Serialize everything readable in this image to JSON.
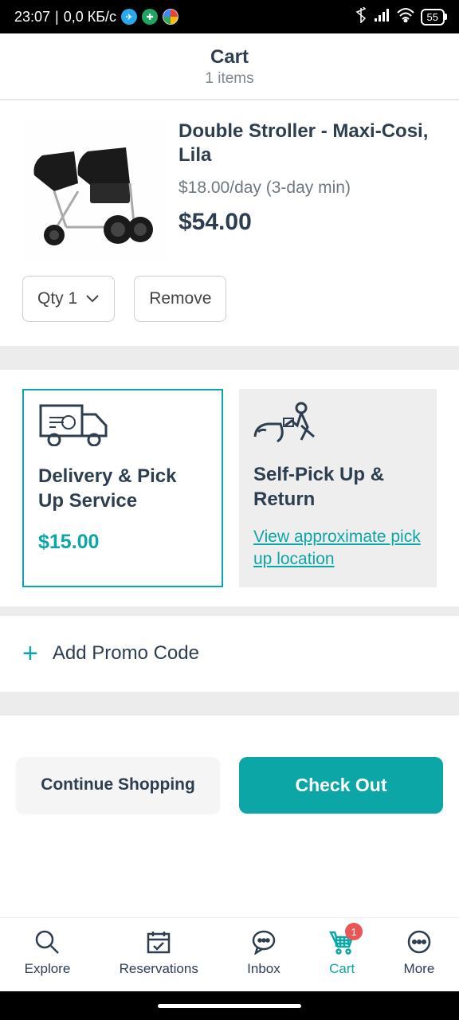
{
  "status": {
    "time": "23:07",
    "net_speed": "0,0 КБ/с",
    "battery": "55"
  },
  "header": {
    "title": "Cart",
    "subtitle": "1 items"
  },
  "item": {
    "name": "Double Stroller - Maxi-Cosi, Lila",
    "rate": "$18.00/day (3-day min)",
    "total": "$54.00",
    "qty_label": "Qty 1",
    "remove_label": "Remove"
  },
  "delivery": {
    "option1": {
      "title": "Delivery & Pick Up Service",
      "price": "$15.00"
    },
    "option2": {
      "title": "Self-Pick Up & Return",
      "link": "View approximate pick up location"
    }
  },
  "promo": {
    "label": "Add Promo Code"
  },
  "buttons": {
    "continue": "Continue Shopping",
    "checkout": "Check Out"
  },
  "nav": {
    "explore": "Explore",
    "reservations": "Reservations",
    "inbox": "Inbox",
    "cart": "Cart",
    "more": "More",
    "cart_badge": "1"
  }
}
